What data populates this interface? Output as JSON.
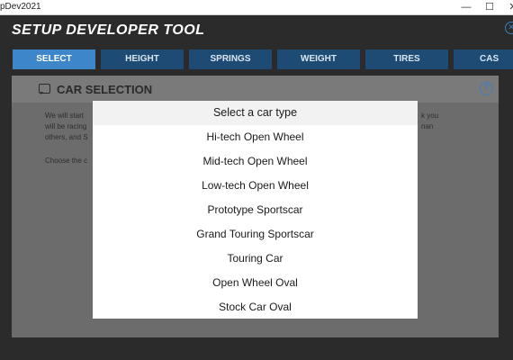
{
  "window": {
    "title": "pDev2021",
    "min_glyph": "—",
    "max_glyph": "☐",
    "close_glyph": "✕"
  },
  "app": {
    "heading": "SETUP DEVELOPER TOOL"
  },
  "tabs": [
    {
      "label": "SELECT",
      "active": true
    },
    {
      "label": "HEIGHT"
    },
    {
      "label": "SPRINGS"
    },
    {
      "label": "WEIGHT"
    },
    {
      "label": "TIRES"
    },
    {
      "label": "CAS"
    }
  ],
  "panel": {
    "title": "CAR SELECTION",
    "help_glyph": "?",
    "text_left_1": "We will start",
    "text_left_2": "will be racing",
    "text_left_3": "others, and S",
    "text_left_4": "Choose the c",
    "text_right_1": "k you",
    "text_right_2": "nan"
  },
  "popup": {
    "title": "Select a car type",
    "options": [
      "Hi-tech Open Wheel",
      "Mid-tech Open Wheel",
      "Low-tech Open Wheel",
      "Prototype Sportscar",
      "Grand Touring Sportscar",
      "Touring Car",
      "Open Wheel Oval",
      "Stock Car Oval"
    ]
  },
  "colors": {
    "tab": "#1e4b74",
    "tab_active": "#3d86c9",
    "accent": "#3d7fbf",
    "panel": "#6c6c6c",
    "background": "#2b2b2b"
  },
  "icons": {
    "corner": "close-circle-icon",
    "chat": "chat-bubble-icon",
    "help": "help-icon"
  }
}
